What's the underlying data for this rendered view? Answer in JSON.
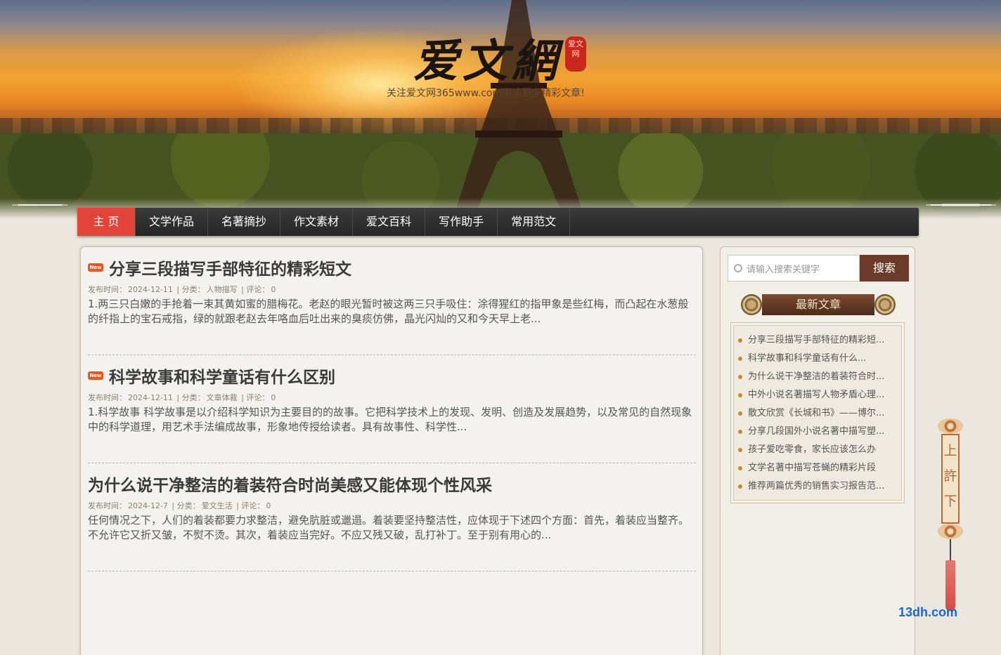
{
  "site": {
    "logo": "爱文網",
    "seal": "爱文网",
    "tagline": "关注爱文网365www.com阅读更多精彩文章!"
  },
  "nav": [
    "主 页",
    "文学作品",
    "名著摘抄",
    "作文素材",
    "爱文百科",
    "写作助手",
    "常用范文"
  ],
  "posts": [
    {
      "is_new": true,
      "badge": "New",
      "title": "分享三段描写手部特征的精彩短文",
      "date_label": "发布时间：",
      "date": "2024-12-11",
      "cat_label": "分类：",
      "category": "人物描写",
      "comment_label": "评论：",
      "comments": "0",
      "excerpt": "1.两三只白嫩的手抢着一束其黄如蜜的腊梅花。老赵的眼光暂时被这两三只手吸住：涂得猩红的指甲象是些红梅，而凸起在水葱般的纤指上的宝石戒指，绿的就跟老赵去年咯血后吐出来的臭痰仿佛，晶光闪灿的又和今天早上老..."
    },
    {
      "is_new": true,
      "badge": "New",
      "title": "科学故事和科学童话有什么区别",
      "date_label": "发布时间：",
      "date": "2024-12-11",
      "cat_label": "分类：",
      "category": "文章体裁",
      "comment_label": "评论：",
      "comments": "0",
      "excerpt": "1.科学故事 科学故事是以介绍科学知识为主要目的的故事。它把科学技术上的发现、发明、创造及发展趋势，以及常见的自然现象中的科学道理，用艺术手法编成故事，形象地传授给读者。具有故事性、科学性..."
    },
    {
      "is_new": false,
      "badge": "",
      "title": "为什么说干净整洁的着装符合时尚美感又能体现个性风采",
      "date_label": "发布时间：",
      "date": "2024-12-7",
      "cat_label": "分类：",
      "category": "爱文生活",
      "comment_label": "评论：",
      "comments": "0",
      "excerpt": "任何情况之下，人们的着装都要力求整洁，避免肮脏或邋遢。着装要坚持整洁性，应体现于下述四个方面：首先，着装应当整齐。不允许它又折又皱，不熨不烫。其次，着装应当完好。不应又残又破，乱打补丁。至于别有用心的..."
    }
  ],
  "sidebar": {
    "search_placeholder": "请输入搜索关键字",
    "search_button": "搜索",
    "recent_title": "最新文章",
    "recent": [
      "分享三段描写手部特征的精彩短...",
      "科学故事和科学童话有什么...",
      "为什么说干净整洁的着装符合时...",
      "中外小说名著描写人物矛盾心理...",
      "散文欣赏《长城和书》——博尔...",
      "分享几段国外小说名著中描写塑...",
      "孩子爱吃零食，家长应该怎么办",
      "文学名著中描写苍蝇的精彩片段",
      "推荐两篇优秀的销售实习报告范..."
    ]
  },
  "scroll_text": "上\n許\n下",
  "watermark": "13dh.com",
  "colors": {
    "nav_active": "#e2443a",
    "nav_bg": "#262626",
    "search_btn": "#6b3a2a"
  }
}
